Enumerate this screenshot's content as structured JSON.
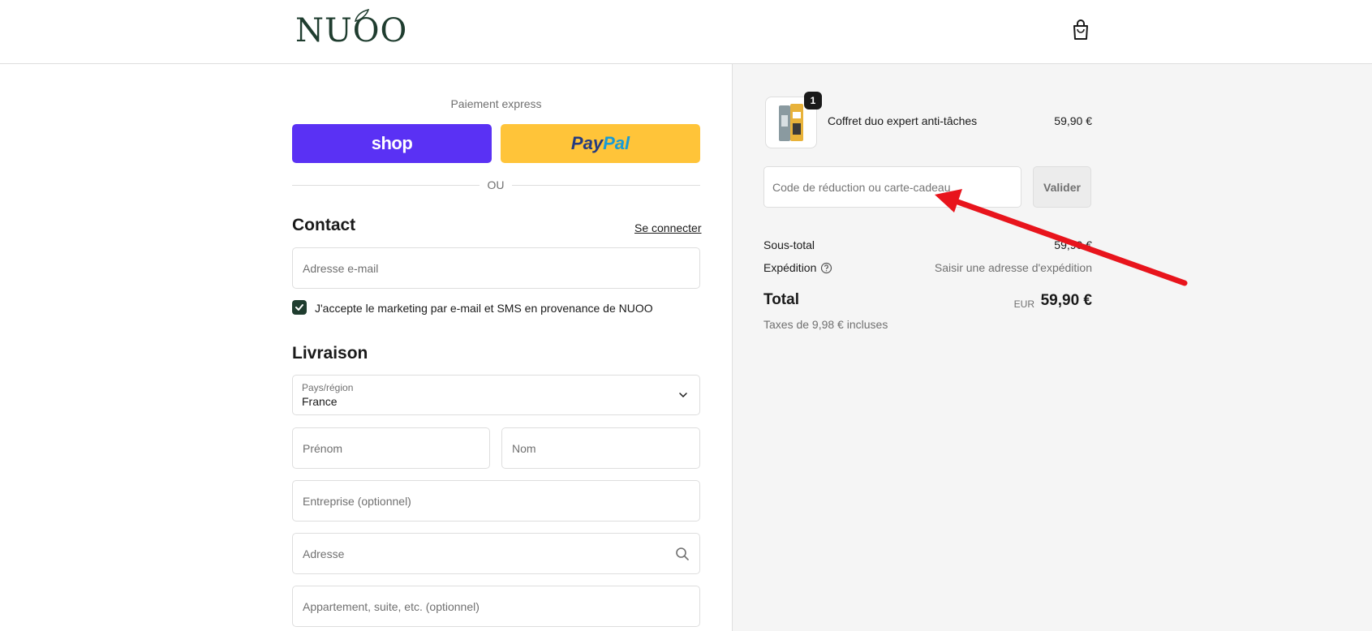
{
  "header": {
    "logo_text": "NUOO"
  },
  "express": {
    "label": "Paiement express",
    "shop_label": "shop",
    "paypal_part1": "Pay",
    "paypal_part2": "Pal",
    "divider_text": "OU"
  },
  "contact": {
    "title": "Contact",
    "login_link": "Se connecter",
    "email_placeholder": "Adresse e-mail",
    "marketing_label": "J'accepte le marketing par e-mail et SMS en provenance de NUOO",
    "marketing_checked": true
  },
  "delivery": {
    "title": "Livraison",
    "country_label": "Pays/région",
    "country_value": "France",
    "firstname_placeholder": "Prénom",
    "lastname_placeholder": "Nom",
    "company_placeholder": "Entreprise (optionnel)",
    "address_placeholder": "Adresse",
    "apartment_placeholder": "Appartement, suite, etc. (optionnel)"
  },
  "summary": {
    "item": {
      "name": "Coffret duo expert anti-tâches",
      "price": "59,90 €",
      "quantity": "1"
    },
    "discount_placeholder": "Code de réduction ou carte-cadeau",
    "validate_label": "Valider",
    "subtotal_label": "Sous-total",
    "subtotal_value": "59,90 €",
    "shipping_label": "Expédition",
    "shipping_value": "Saisir une adresse d'expédition",
    "total_label": "Total",
    "total_currency": "EUR",
    "total_value": "59,90 €",
    "taxes_note": "Taxes de 9,98 € incluses"
  },
  "colors": {
    "shop_purple": "#5a31f4",
    "paypal_yellow": "#ffc439",
    "brand_green": "#1f3d2f",
    "annotation_red": "#e8141c"
  }
}
